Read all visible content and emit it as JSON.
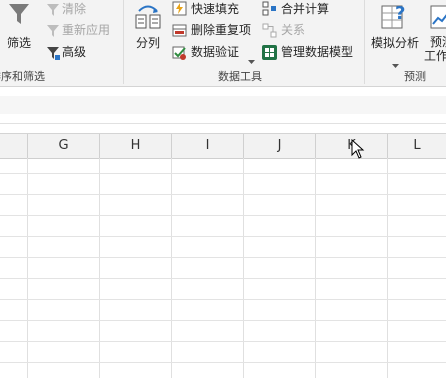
{
  "ribbon": {
    "sort_filter": {
      "filter_label": "筛选",
      "clear_label": "清除",
      "reapply_label": "重新应用",
      "advanced_label": "高级",
      "group_label": "排序和筛选"
    },
    "data_tools": {
      "text_to_columns_label": "分列",
      "flash_fill_label": "快速填充",
      "remove_duplicates_label": "删除重复项",
      "data_validation_label": "数据验证",
      "consolidate_label": "合并计算",
      "relationships_label": "关系",
      "manage_data_model_label": "管理数据模型",
      "group_label": "数据工具"
    },
    "forecast": {
      "what_if_label": "模拟分析",
      "forecast_sheet_label_top": "预测",
      "forecast_sheet_label_bottom": "工作",
      "group_label": "预测"
    }
  },
  "columns": [
    "G",
    "H",
    "I",
    "J",
    "K",
    "L"
  ],
  "colors": {
    "accent_green": "#217346",
    "ribbon_bg": "#f3f3f3",
    "grid_line": "#e0e0e0"
  }
}
